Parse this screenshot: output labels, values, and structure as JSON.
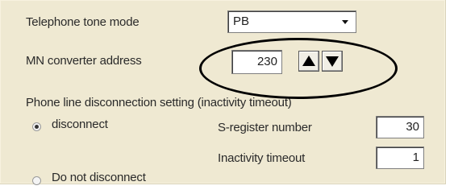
{
  "tone_mode": {
    "label": "Telephone tone mode",
    "value": "PB"
  },
  "mn_address": {
    "label": "MN converter address",
    "value": "230"
  },
  "disconnection": {
    "section_label": "Phone line disconnection setting (inactivity timeout)",
    "disconnect_label": "disconnect",
    "do_not_disconnect_label": "Do not disconnect",
    "selected": "disconnect",
    "s_register": {
      "label": "S-register number",
      "value": "30"
    },
    "inactivity": {
      "label": "Inactivity timeout",
      "value": "1"
    }
  },
  "colors": {
    "panel_background": "#efe9d2",
    "highlight_ellipse": "#000000"
  }
}
